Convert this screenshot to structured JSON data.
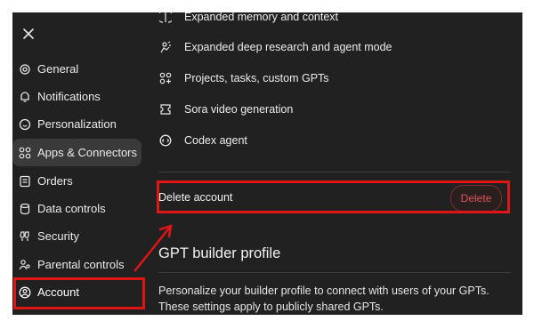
{
  "sidebar": {
    "close_icon": "close-icon",
    "items": [
      {
        "label": "General",
        "icon": "gear-icon"
      },
      {
        "label": "Notifications",
        "icon": "bell-icon"
      },
      {
        "label": "Personalization",
        "icon": "personalization-icon"
      },
      {
        "label": "Apps & Connectors",
        "icon": "apps-icon",
        "active": true
      },
      {
        "label": "Orders",
        "icon": "orders-icon"
      },
      {
        "label": "Data controls",
        "icon": "database-icon"
      },
      {
        "label": "Security",
        "icon": "security-icon"
      },
      {
        "label": "Parental controls",
        "icon": "parental-icon"
      },
      {
        "label": "Account",
        "icon": "account-icon"
      }
    ]
  },
  "features": [
    {
      "label": "Expanded memory and context",
      "icon": "memory-icon"
    },
    {
      "label": "Expanded deep research and agent mode",
      "icon": "research-icon"
    },
    {
      "label": "Projects, tasks, custom GPTs",
      "icon": "projects-icon"
    },
    {
      "label": "Sora video generation",
      "icon": "sora-icon"
    },
    {
      "label": "Codex agent",
      "icon": "codex-icon"
    }
  ],
  "delete_account": {
    "label": "Delete account",
    "button_label": "Delete"
  },
  "builder_profile": {
    "title": "GPT builder profile",
    "description": "Personalize your builder profile to connect with users of your GPTs. These settings apply to publicly shared GPTs."
  },
  "colors": {
    "background": "#212121",
    "active_item": "#3a3a3a",
    "danger": "#e0565b",
    "highlight": "#e01616"
  }
}
